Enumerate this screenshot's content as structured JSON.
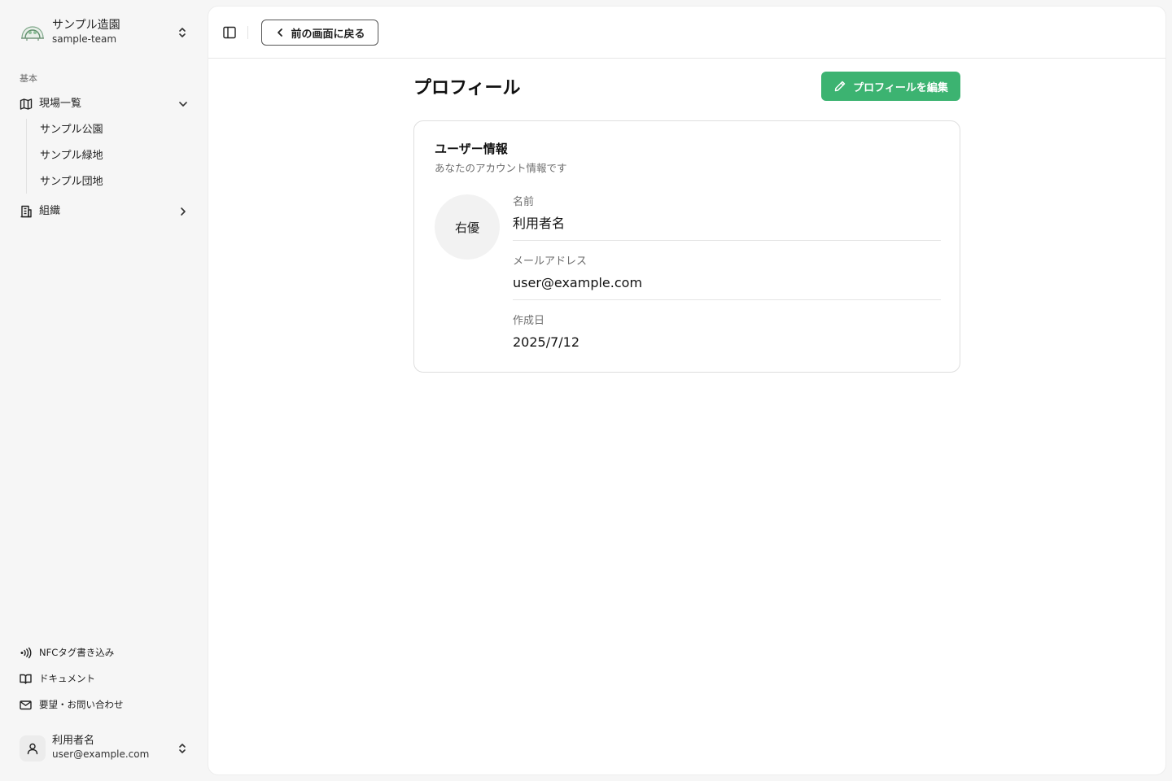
{
  "sidebar": {
    "team": {
      "name": "サンプル造園",
      "slug": "sample-team",
      "logo_icon": "garden-tree-logo"
    },
    "group_label": "基本",
    "nav": [
      {
        "label": "現場一覧",
        "icon": "map-icon",
        "expanded": true
      },
      {
        "label": "組織",
        "icon": "building-icon",
        "expanded": false
      }
    ],
    "sites": [
      "サンプル公園",
      "サンプル緑地",
      "サンプル団地"
    ],
    "footer": [
      {
        "label": "NFCタグ書き込み",
        "icon": "nfc-icon"
      },
      {
        "label": "ドキュメント",
        "icon": "book-icon"
      },
      {
        "label": "要望・お問い合わせ",
        "icon": "mail-icon"
      }
    ],
    "user": {
      "name": "利用者名",
      "email": "user@example.com"
    }
  },
  "topbar": {
    "back_label": "前の画面に戻る"
  },
  "page": {
    "title": "プロフィール",
    "edit_label": "プロフィールを編集"
  },
  "card": {
    "title": "ユーザー情報",
    "description": "あなたのアカウント情報です",
    "avatar_text": "右優",
    "fields": [
      {
        "label": "名前",
        "value": "利用者名"
      },
      {
        "label": "メールアドレス",
        "value": "user@example.com"
      },
      {
        "label": "作成日",
        "value": "2025/7/12"
      }
    ]
  },
  "colors": {
    "accent": "#3cb371",
    "background": "#f6f6f6",
    "panel": "#ffffff"
  }
}
